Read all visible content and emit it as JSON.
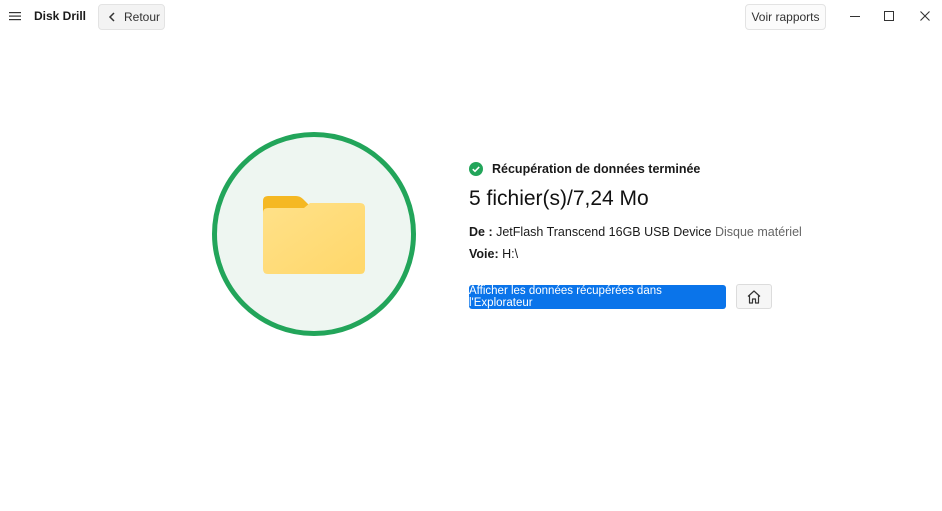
{
  "titlebar": {
    "app_title": "Disk Drill",
    "back_label": "Retour",
    "reports_label": "Voir rapports"
  },
  "result": {
    "status_text": "Récupération de données terminée",
    "summary": "5 fichier(s)/7,24 Mo",
    "from_label": "De :",
    "device_name": "JetFlash Transcend 16GB USB Device",
    "device_type": "Disque matériel",
    "path_label": "Voie:",
    "path_value": "H:\\"
  },
  "actions": {
    "explorer_label": "Afficher les données récupérées dans l'Explorateur"
  },
  "colors": {
    "accent_blue": "#0a74ea",
    "success_green": "#22a55a",
    "folder_yellow": "#ffc83d"
  },
  "icons": [
    "hamburger-menu-icon",
    "chevron-left-icon",
    "minimize-icon",
    "maximize-icon",
    "close-icon",
    "check-circle-icon",
    "folder-icon",
    "home-icon"
  ]
}
